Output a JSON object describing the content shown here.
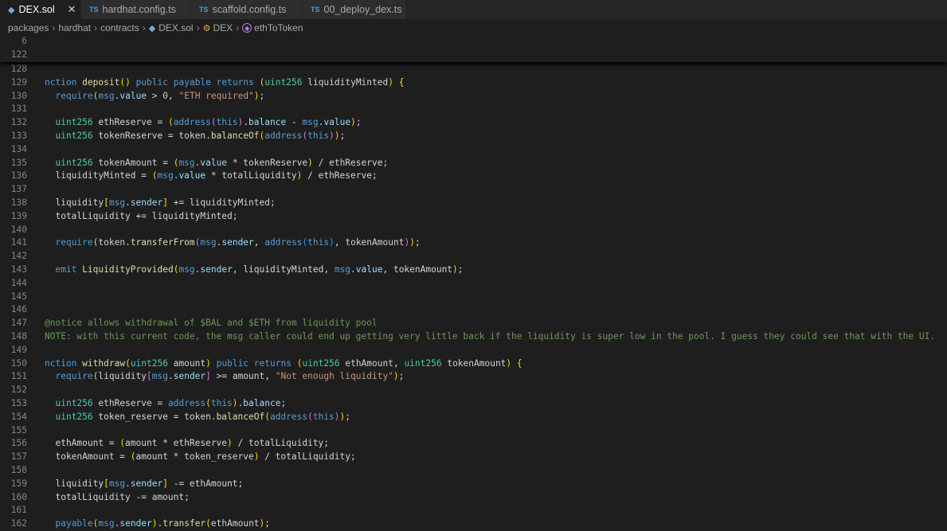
{
  "tabs": [
    {
      "icon": "ethereum-icon",
      "label": "DEX.sol",
      "active": true
    },
    {
      "icon": "ts-icon",
      "icon_text": "TS",
      "label": "hardhat.config.ts"
    },
    {
      "icon": "ts-icon",
      "icon_text": "TS",
      "label": "scaffold.config.ts"
    },
    {
      "icon": "ts-icon",
      "icon_text": "TS",
      "label": "00_deploy_dex.ts"
    }
  ],
  "breadcrumb": [
    "packages",
    "hardhat",
    "contracts",
    "DEX.sol",
    "DEX",
    "ethToToken"
  ],
  "sticky_lines": [
    "6",
    "122"
  ],
  "lines": [
    {
      "n": "128",
      "t": ""
    },
    {
      "n": "129",
      "t": "nction deposit() public payable returns (uint256 liquidityMinted) {"
    },
    {
      "n": "130",
      "t": "  require(msg.value > 0, \"ETH required\");"
    },
    {
      "n": "131",
      "t": ""
    },
    {
      "n": "132",
      "t": "  uint256 ethReserve = (address(this).balance - msg.value);"
    },
    {
      "n": "133",
      "t": "  uint256 tokenReserve = token.balanceOf(address(this));"
    },
    {
      "n": "134",
      "t": ""
    },
    {
      "n": "135",
      "t": "  uint256 tokenAmount = (msg.value * tokenReserve) / ethReserve;"
    },
    {
      "n": "136",
      "t": "  liquidityMinted = (msg.value * totalLiquidity) / ethReserve;"
    },
    {
      "n": "137",
      "t": ""
    },
    {
      "n": "138",
      "t": "  liquidity[msg.sender] += liquidityMinted;"
    },
    {
      "n": "139",
      "t": "  totalLiquidity += liquidityMinted;"
    },
    {
      "n": "140",
      "t": ""
    },
    {
      "n": "141",
      "t": "  require(token.transferFrom(msg.sender, address(this), tokenAmount));"
    },
    {
      "n": "142",
      "t": ""
    },
    {
      "n": "143",
      "t": "  emit LiquidityProvided(msg.sender, liquidityMinted, msg.value, tokenAmount);"
    },
    {
      "n": "144",
      "t": ""
    },
    {
      "n": "145",
      "t": ""
    },
    {
      "n": "146",
      "t": ""
    },
    {
      "n": "147",
      "t": "@notice allows withdrawal of $BAL and $ETH from liquidity pool"
    },
    {
      "n": "148",
      "t": "NOTE: with this current code, the msg caller could end up getting very little back if the liquidity is super low in the pool. I guess they could see that with the UI."
    },
    {
      "n": "149",
      "t": ""
    },
    {
      "n": "150",
      "t": "nction withdraw(uint256 amount) public returns (uint256 ethAmount, uint256 tokenAmount) {"
    },
    {
      "n": "151",
      "t": "  require(liquidity[msg.sender] >= amount, \"Not enough liquidity\");"
    },
    {
      "n": "152",
      "t": ""
    },
    {
      "n": "153",
      "t": "  uint256 ethReserve = address(this).balance;"
    },
    {
      "n": "154",
      "t": "  uint256 token_reserve = token.balanceOf(address(this));"
    },
    {
      "n": "155",
      "t": ""
    },
    {
      "n": "156",
      "t": "  ethAmount = (amount * ethReserve) / totalLiquidity;"
    },
    {
      "n": "157",
      "t": "  tokenAmount = (amount * token_reserve) / totalLiquidity;"
    },
    {
      "n": "158",
      "t": ""
    },
    {
      "n": "159",
      "t": "  liquidity[msg.sender] -= ethAmount;"
    },
    {
      "n": "160",
      "t": "  totalLiquidity -= amount;"
    },
    {
      "n": "161",
      "t": ""
    },
    {
      "n": "162",
      "t": "  payable(msg.sender).transfer(ethAmount);"
    }
  ]
}
